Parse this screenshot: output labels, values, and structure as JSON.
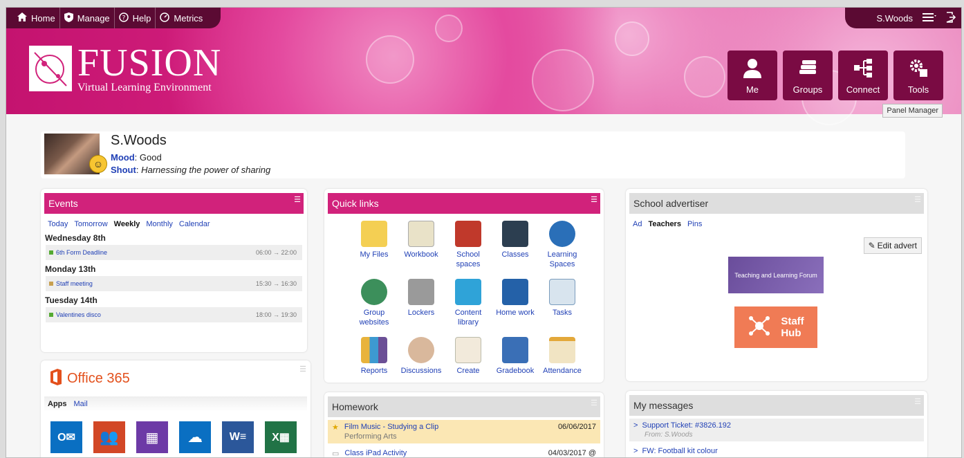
{
  "topbar": {
    "home": "Home",
    "manage": "Manage",
    "help": "Help",
    "metrics": "Metrics",
    "user": "S.Woods"
  },
  "logo": {
    "title": "FUSION",
    "subtitle": "Virtual Learning Environment"
  },
  "tiles": [
    {
      "label": "Me"
    },
    {
      "label": "Groups"
    },
    {
      "label": "Connect"
    },
    {
      "label": "Tools"
    }
  ],
  "tooltip": "Panel Manager",
  "profile": {
    "name": "S.Woods",
    "mood_label": "Mood",
    "mood": "Good",
    "shout_label": "Shout",
    "shout": "Harnessing the power of sharing"
  },
  "events": {
    "title": "Events",
    "tabs": [
      "Today",
      "Tomorrow",
      "Weekly",
      "Monthly",
      "Calendar"
    ],
    "days": [
      {
        "day": "Wednesday 8th",
        "name": "6th Form Deadline",
        "time": "06:00 → 22:00",
        "color": "#55aa33"
      },
      {
        "day": "Monday 13th",
        "name": "Staff meeting",
        "time": "15:30 → 16:30",
        "color": "#c8a050"
      },
      {
        "day": "Tuesday 14th",
        "name": "Valentines disco",
        "time": "18:00 → 19:30",
        "color": "#55aa33"
      }
    ]
  },
  "quicklinks": {
    "title": "Quick links",
    "items": [
      "My Files",
      "Workbook",
      "School spaces",
      "Classes",
      "Learning Spaces",
      "Group websites",
      "Lockers",
      "Content library",
      "Home work",
      "Tasks",
      "Reports",
      "Discussions",
      "Create",
      "Gradebook",
      "Attendance"
    ]
  },
  "advertiser": {
    "title": "School advertiser",
    "tabs": [
      "Ad",
      "Teachers",
      "Pins"
    ],
    "edit": "Edit advert",
    "banner1": "Teaching and Learning Forum",
    "banner2a": "Staff",
    "banner2b": "Hub"
  },
  "office": {
    "title": "Office 365",
    "tabs": [
      "Apps",
      "Mail"
    ]
  },
  "homework": {
    "title": "Homework",
    "items": [
      {
        "title": "Film Music - Studying a Clip",
        "sub": "Performing Arts",
        "date": "06/06/2017"
      },
      {
        "title": "Class iPad Activity",
        "sub": "",
        "date": "04/03/2017 @"
      }
    ]
  },
  "messages": {
    "title": "My messages",
    "items": [
      {
        "title": "Support Ticket: #3826.192",
        "from": "From: S.Woods"
      },
      {
        "title": "FW: Football kit colour",
        "from": ""
      }
    ]
  }
}
